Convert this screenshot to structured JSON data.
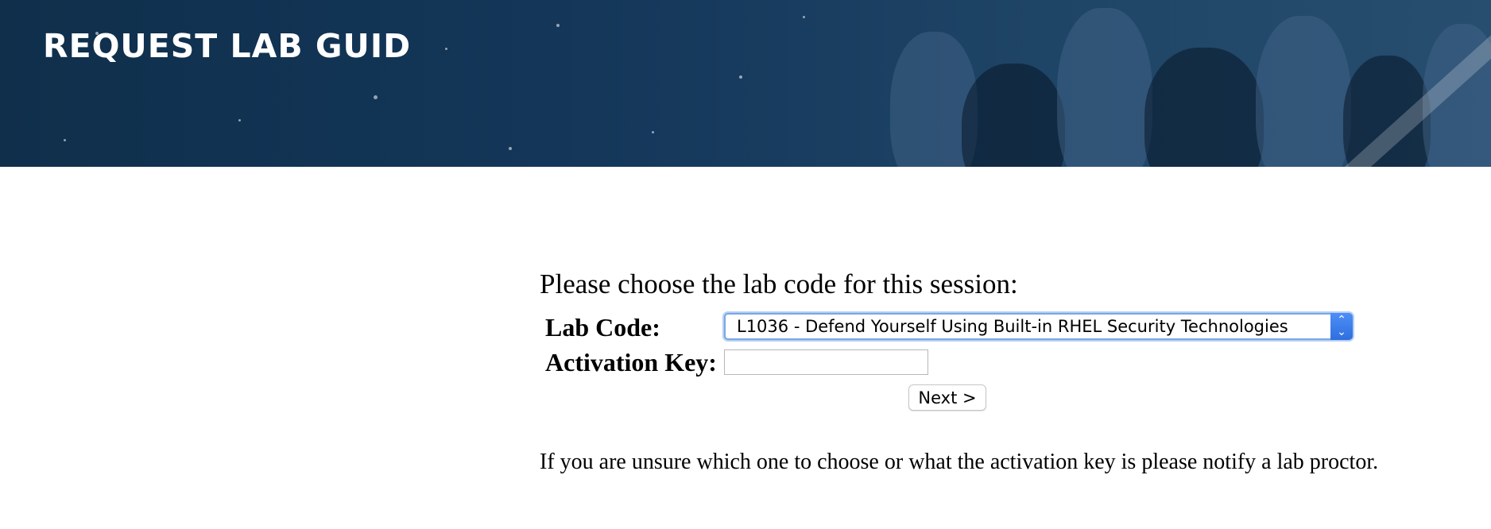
{
  "banner": {
    "title": "REQUEST LAB GUID"
  },
  "form": {
    "prompt": "Please choose the lab code for this session:",
    "lab_code_label": "Lab Code:",
    "lab_code_selected": "L1036 - Defend Yourself Using Built-in RHEL Security Technologies",
    "activation_key_label": "Activation Key:",
    "activation_key_value": "",
    "next_label": "Next >",
    "note": "If you are unsure which one to choose or what the activation key is please notify a lab proctor."
  },
  "icons": {
    "select_arrows": "up-down-chevron-icon"
  },
  "colors": {
    "banner": "#14375a",
    "select_accent": "#2f6fdf"
  }
}
